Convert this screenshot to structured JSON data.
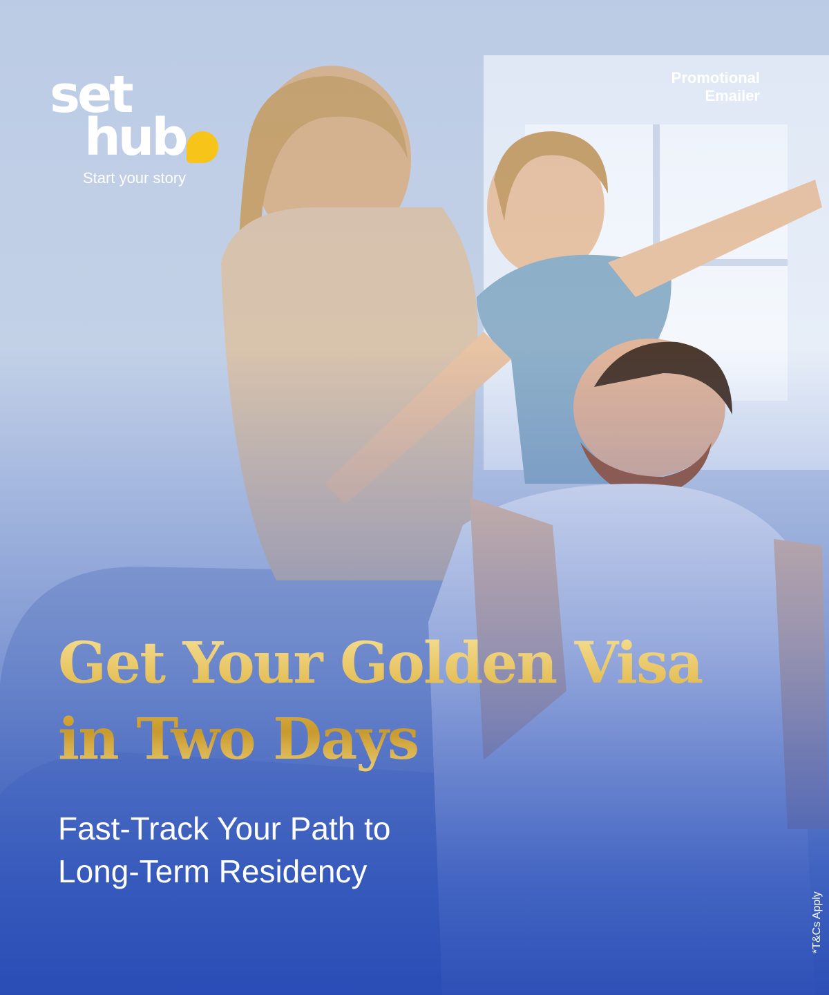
{
  "brand": {
    "logo_line1": "set",
    "logo_line2": "hub",
    "tagline": "Start your story",
    "accent_color": "#f7c41a"
  },
  "label": {
    "line1": "Promotional",
    "line2": "Emailer"
  },
  "headline": {
    "line1": "Get Your Golden Visa",
    "line2": "in Two Days",
    "color": "#e1b84b"
  },
  "subline": {
    "line1": "Fast-Track Your Path to",
    "line2": "Long-Term Residency"
  },
  "disclaimer": "*T&Cs Apply",
  "colors": {
    "background_blue": "#2f54b6",
    "text_white": "#ffffff"
  }
}
